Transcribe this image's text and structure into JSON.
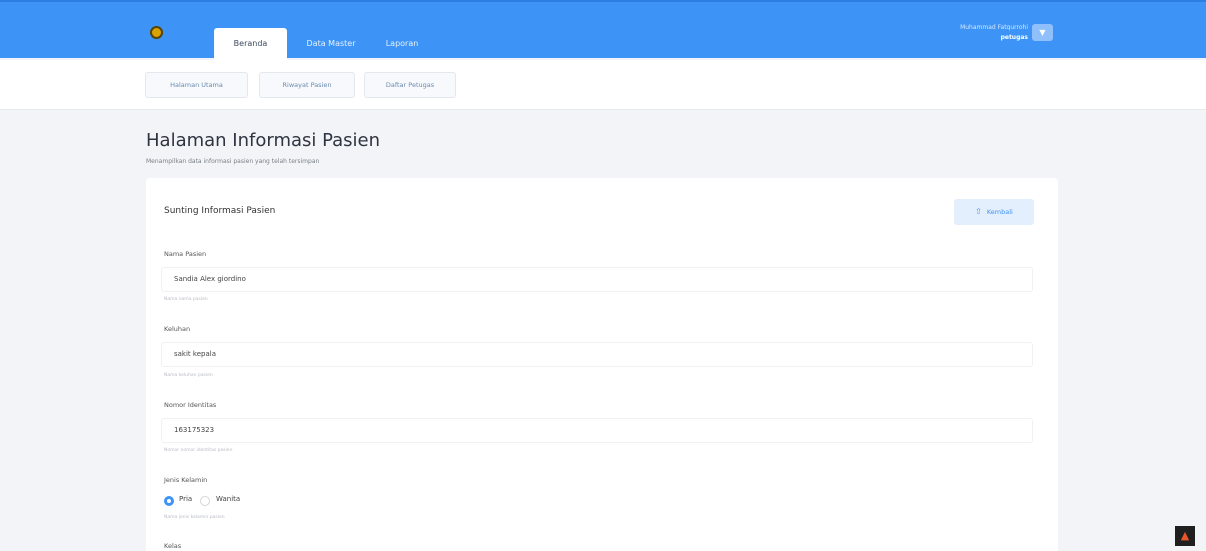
{
  "header": {
    "logo_icon": "app-logo-icon",
    "tabs": [
      {
        "label": "Beranda",
        "active": true
      },
      {
        "label": "Data Master",
        "active": false
      },
      {
        "label": "Laporan",
        "active": false
      }
    ],
    "user": {
      "name": "Muhammad Fatqurrohi",
      "role": "petugas",
      "menu_icon": "chevron-down-icon"
    },
    "colors": {
      "bar": "#3d94f6",
      "accent": "#3d94f6"
    }
  },
  "subnav": {
    "items": [
      "Halaman Utama",
      "Riwayat Pasien",
      "Daftar Petugas"
    ]
  },
  "page": {
    "title": "Halaman Informasi Pasien",
    "subtitle": "Menampilkan data informasi pasien yang telah tersimpan"
  },
  "card": {
    "title": "Sunting Informasi Pasien",
    "back_button": {
      "label": "Kembali",
      "icon": "arrow-up-icon"
    },
    "fields": [
      {
        "label": "Nama Pasien",
        "value": "Sandia Alex giordino",
        "help": "Nama nama pasien"
      },
      {
        "label": "Keluhan",
        "value": "sakit kepala",
        "help": "Nama keluhan pasien"
      },
      {
        "label": "Nomor Identitas",
        "value": "163175323",
        "help": "Nomor nomor identitas pasien"
      }
    ],
    "gender": {
      "label": "Jenis Kelamin",
      "options": [
        "Pria",
        "Wanita"
      ],
      "selected": "Pria",
      "help": "Nama jenis kelamin pasien"
    },
    "next_label": "Kelas"
  },
  "corner": {
    "icon": "warning-icon",
    "glyph": "▲"
  }
}
